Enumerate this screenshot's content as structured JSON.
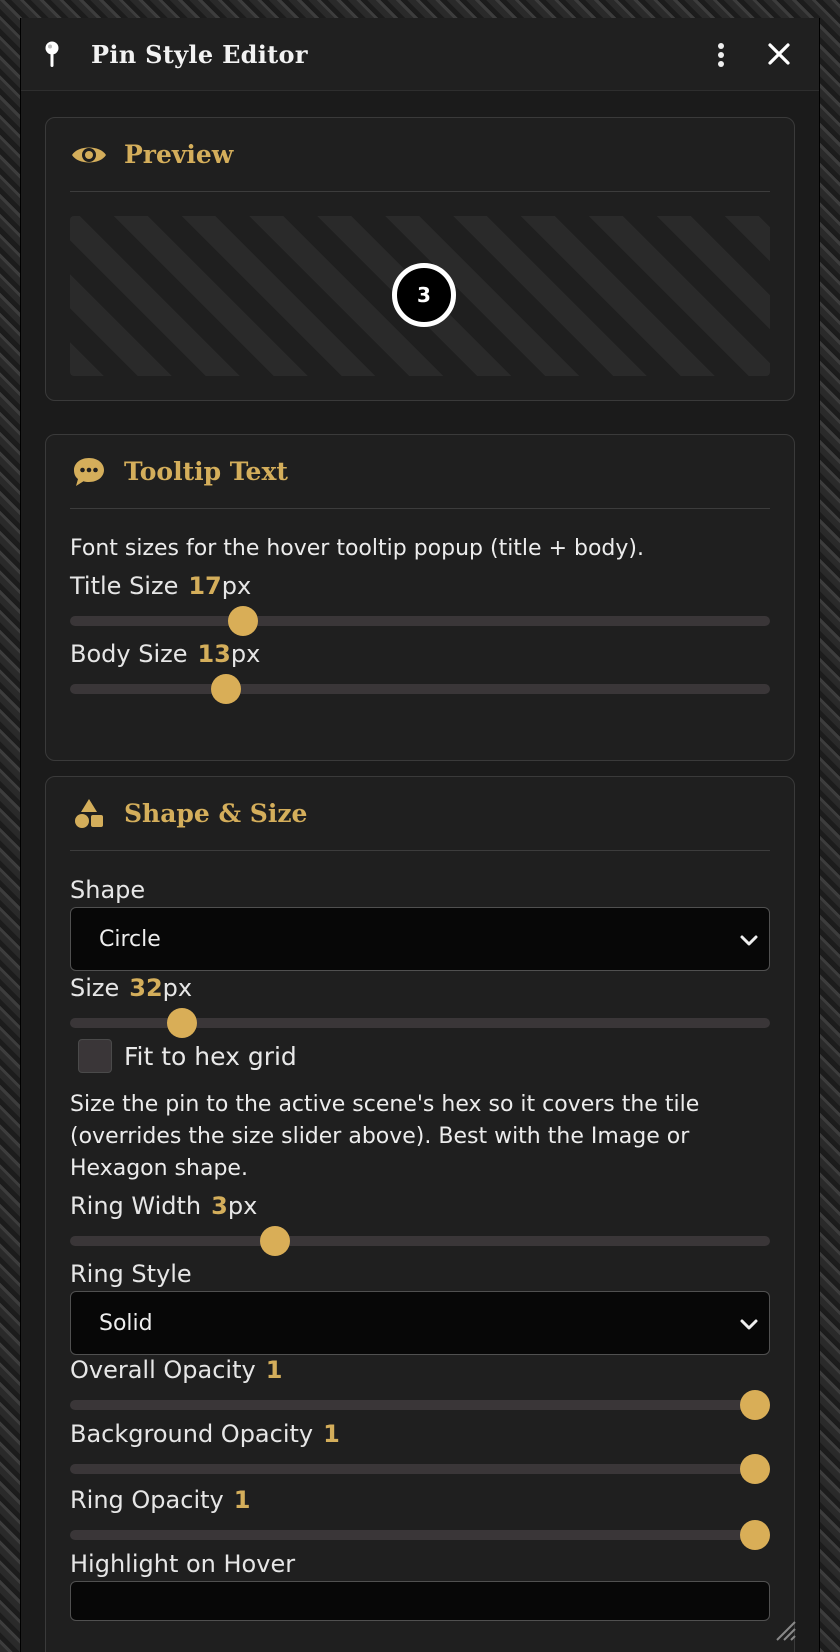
{
  "window": {
    "title": "Pin Style Editor"
  },
  "preview": {
    "heading": "Preview",
    "pin_label": "3"
  },
  "tooltip": {
    "heading": "Tooltip Text",
    "description": "Font sizes for the hover tooltip popup (title + body).",
    "title_size_label": "Title Size",
    "title_size_value": "17",
    "title_size_unit": "px",
    "title_size_fraction": 0.247,
    "body_size_label": "Body Size",
    "body_size_value": "13",
    "body_size_unit": "px",
    "body_size_fraction": 0.223
  },
  "shape": {
    "heading": "Shape & Size",
    "shape_label": "Shape",
    "shape_selected": "Circle",
    "size_label": "Size",
    "size_value": "32",
    "size_unit": "px",
    "size_fraction": 0.16,
    "fit_label": "Fit to hex grid",
    "fit_checked": false,
    "fit_description": "Size the pin to the active scene's hex so it covers the tile (overrides the size slider above). Best with the Image or Hexagon shape.",
    "ring_width_label": "Ring Width",
    "ring_width_value": "3",
    "ring_width_unit": "px",
    "ring_width_fraction": 0.293,
    "ring_style_label": "Ring Style",
    "ring_style_selected": "Solid",
    "overall_opacity_label": "Overall Opacity",
    "overall_opacity_value": "1",
    "background_opacity_label": "Background Opacity",
    "background_opacity_value": "1",
    "ring_opacity_label": "Ring Opacity",
    "ring_opacity_value": "1",
    "highlight_label": "Highlight on Hover"
  },
  "colors": {
    "accent": "#d4ae5b",
    "thumb": "#d9ae57",
    "track": "#3a3638"
  }
}
